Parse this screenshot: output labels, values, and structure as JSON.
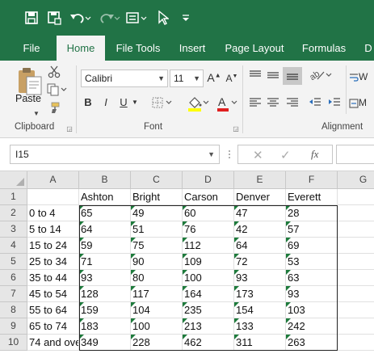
{
  "tabs": [
    "File",
    "Home",
    "File Tools",
    "Insert",
    "Page Layout",
    "Formulas",
    "D"
  ],
  "active_tab": "Home",
  "ribbon": {
    "paste_label": "Paste",
    "font_name": "Calibri",
    "font_size": "11",
    "bold": "B",
    "italic": "I",
    "underline": "U",
    "font_color_glyph": "A",
    "wrap_label": "W",
    "merge_label": "M",
    "groups": {
      "clipboard": "Clipboard",
      "font": "Font",
      "alignment": "Alignment"
    }
  },
  "formula_bar": {
    "name_box": "I15",
    "fx": "fx",
    "formula": ""
  },
  "columns": [
    "A",
    "B",
    "C",
    "D",
    "E",
    "F",
    "G"
  ],
  "rows": [
    "1",
    "2",
    "3",
    "4",
    "5",
    "6",
    "7",
    "8",
    "9",
    "10"
  ],
  "table": {
    "header": [
      "",
      "Ashton",
      "Bright",
      "Carson",
      "Denver",
      "Everett"
    ],
    "data": [
      [
        "0 to 4",
        "65",
        "49",
        "60",
        "47",
        "28"
      ],
      [
        "5 to 14",
        "64",
        "51",
        "76",
        "42",
        "57"
      ],
      [
        "15 to 24",
        "59",
        "75",
        "112",
        "64",
        "69"
      ],
      [
        "25 to 34",
        "71",
        "90",
        "109",
        "72",
        "53"
      ],
      [
        "35 to 44",
        "93",
        "80",
        "100",
        "93",
        "63"
      ],
      [
        "45 to 54",
        "128",
        "117",
        "164",
        "173",
        "93"
      ],
      [
        "55 to 64",
        "159",
        "104",
        "235",
        "154",
        "103"
      ],
      [
        "65 to 74",
        "183",
        "100",
        "213",
        "133",
        "242"
      ],
      [
        "74 and ove",
        "349",
        "228",
        "462",
        "311",
        "263"
      ]
    ]
  },
  "colors": {
    "brand": "#217346",
    "error_marker": "#1e7b3c"
  }
}
